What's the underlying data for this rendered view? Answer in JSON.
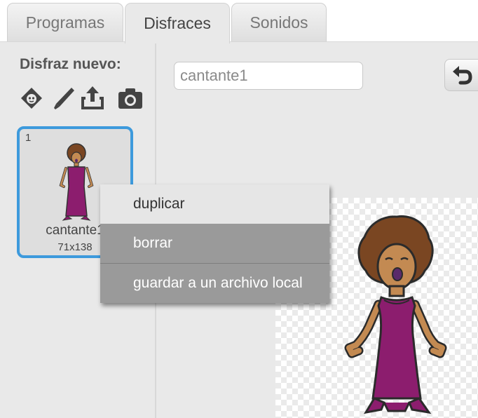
{
  "tabs": [
    {
      "label": "Programas",
      "active": false
    },
    {
      "label": "Disfraces",
      "active": true
    },
    {
      "label": "Sonidos",
      "active": false
    }
  ],
  "sidebar": {
    "title": "Disfraz nuevo:",
    "buttons": [
      "sprite-library-icon",
      "paint-brush-icon",
      "upload-icon",
      "camera-icon"
    ]
  },
  "costume": {
    "number": "1",
    "name": "cantante1",
    "size": "71x138"
  },
  "editor": {
    "name_value": "cantante1"
  },
  "context_menu": {
    "items": [
      "duplicar",
      "borrar",
      "guardar a un archivo local"
    ]
  },
  "colors": {
    "accent": "#3d9adc",
    "dress": "#8c1d6e",
    "hair": "#7a4622",
    "skin": "#c38a52"
  }
}
